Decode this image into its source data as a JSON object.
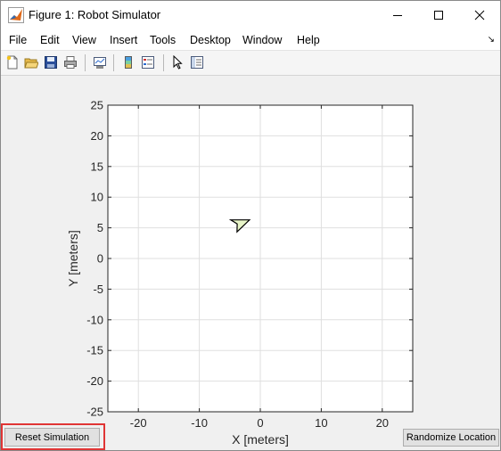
{
  "window": {
    "title": "Figure 1: Robot Simulator",
    "controls": [
      "minimize",
      "maximize",
      "close"
    ]
  },
  "menubar": {
    "items": [
      "File",
      "Edit",
      "View",
      "Insert",
      "Tools",
      "Desktop",
      "Window",
      "Help"
    ],
    "overflow_arrow": "↘"
  },
  "toolbar": {
    "buttons": [
      "new-figure-icon",
      "open-file-icon",
      "save-icon",
      "print-icon",
      "link-plot-icon",
      "insert-colorbar-icon",
      "insert-legend-icon",
      "pointer-icon",
      "property-inspector-icon"
    ]
  },
  "chart_data": {
    "type": "scatter",
    "xlabel": "X [meters]",
    "ylabel": "Y [meters]",
    "xlim": [
      -25,
      25
    ],
    "ylim": [
      -25,
      25
    ],
    "xticks": [
      -20,
      -10,
      0,
      10,
      20
    ],
    "yticks": [
      25,
      20,
      15,
      10,
      5,
      0,
      -5,
      -10,
      -15,
      -20,
      -25
    ],
    "grid": true,
    "robot": {
      "x": -3.3,
      "y": 5.8,
      "heading_deg": 18,
      "color": "#e8f5c8",
      "edge_color": "#000000"
    }
  },
  "buttons": {
    "reset": "Reset Simulation",
    "randomize": "Randomize Location"
  },
  "colors": {
    "highlight": "#e03535",
    "figure_background": "#f0f0f0",
    "axes_background": "#ffffff",
    "grid": "#dfdfdf"
  }
}
